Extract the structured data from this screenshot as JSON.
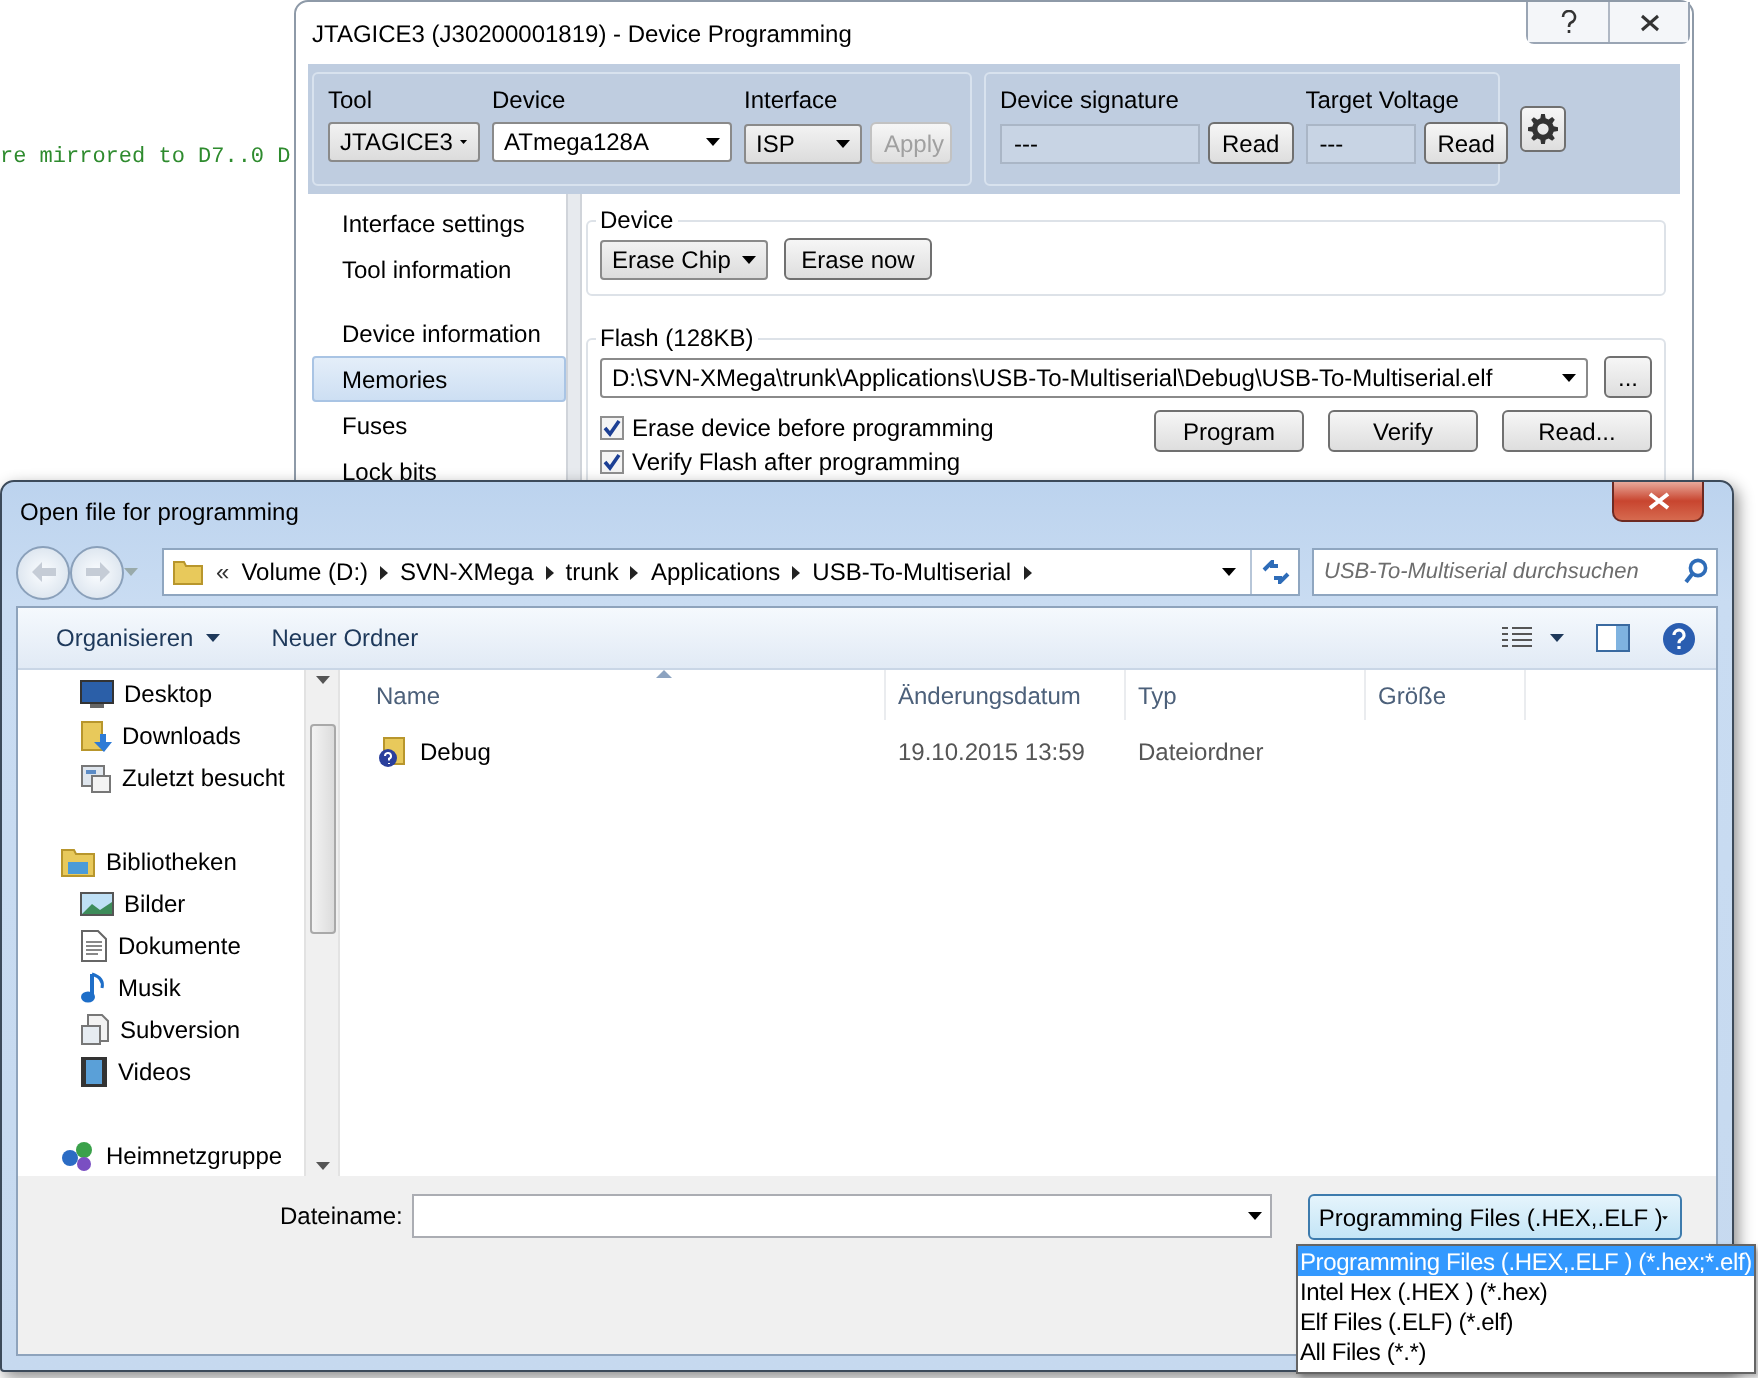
{
  "background_code": "re mirrored to D7..0 D",
  "programming_window": {
    "title": "JTAGICE3 (J30200001819) - Device Programming",
    "toolbar": {
      "tool": {
        "label": "Tool",
        "value": "JTAGICE3"
      },
      "device": {
        "label": "Device",
        "value": "ATmega128A"
      },
      "interface": {
        "label": "Interface",
        "value": "ISP"
      },
      "apply": {
        "label": "Apply",
        "disabled": true
      },
      "signature": {
        "label": "Device signature",
        "value": "---",
        "button": "Read"
      },
      "voltage": {
        "label": "Target Voltage",
        "value": "---",
        "button": "Read"
      }
    },
    "sidebar": {
      "groups": [
        {
          "items": [
            {
              "label": "Interface settings",
              "selected": false
            },
            {
              "label": "Tool information",
              "selected": false
            }
          ]
        },
        {
          "items": [
            {
              "label": "Device information",
              "selected": false
            },
            {
              "label": "Memories",
              "selected": true
            },
            {
              "label": "Fuses",
              "selected": false
            },
            {
              "label": "Lock bits",
              "selected": false
            }
          ]
        }
      ]
    },
    "device_group": {
      "title": "Device",
      "erase_mode": "Erase Chip",
      "erase_button": "Erase now"
    },
    "flash_group": {
      "title": "Flash (128KB)",
      "file": "D:\\SVN-XMega\\trunk\\Applications\\USB-To-Multiserial\\Debug\\USB-To-Multiserial.elf",
      "browse": "...",
      "options": [
        {
          "label": "Erase device before programming",
          "checked": true
        },
        {
          "label": "Verify Flash after programming",
          "checked": true
        }
      ],
      "buttons": [
        "Program",
        "Verify",
        "Read..."
      ]
    }
  },
  "open_dialog": {
    "title": "Open file for programming",
    "address": {
      "overflow_mark": "«",
      "crumbs": [
        "Volume (D:)",
        "SVN-XMega",
        "trunk",
        "Applications",
        "USB-To-Multiserial"
      ]
    },
    "search": {
      "placeholder": "USB-To-Multiserial durchsuchen"
    },
    "toolbar": {
      "organize": "Organisieren",
      "new_folder": "Neuer Ordner"
    },
    "nav": [
      {
        "children": [
          {
            "label": "Desktop",
            "kind": "desktop"
          },
          {
            "label": "Downloads",
            "kind": "downloads"
          },
          {
            "label": "Zuletzt besucht",
            "kind": "recent"
          }
        ]
      },
      {
        "label": "Bibliotheken",
        "kind": "library",
        "children": [
          {
            "label": "Bilder",
            "kind": "pictures"
          },
          {
            "label": "Dokumente",
            "kind": "documents"
          },
          {
            "label": "Musik",
            "kind": "music"
          },
          {
            "label": "Subversion",
            "kind": "subversion"
          },
          {
            "label": "Videos",
            "kind": "videos"
          }
        ]
      },
      {
        "label": "Heimnetzgruppe",
        "kind": "homegroup"
      }
    ],
    "columns": [
      "Name",
      "Änderungsdatum",
      "Typ",
      "Größe"
    ],
    "rows": [
      {
        "name": "Debug",
        "date": "19.10.2015 13:59",
        "type": "Dateiordner"
      }
    ],
    "filename": {
      "label": "Dateiname:"
    },
    "filter": {
      "value": "Programming Files (.HEX,.ELF )"
    },
    "filter_options": [
      {
        "label": "Programming Files (.HEX,.ELF ) (*.hex;*.elf)",
        "selected": true
      },
      {
        "label": "Intel Hex (.HEX ) (*.hex)",
        "selected": false
      },
      {
        "label": "Elf Files (.ELF) (*.elf)",
        "selected": false
      },
      {
        "label": "All Files (*.*)",
        "selected": false
      }
    ]
  }
}
